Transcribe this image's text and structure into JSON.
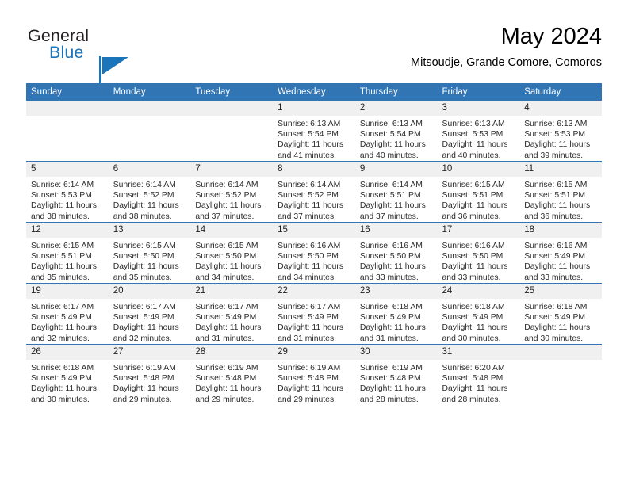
{
  "brand": {
    "name_part1": "General",
    "name_part2": "Blue",
    "accent_color": "#1b75bb"
  },
  "header": {
    "title": "May 2024",
    "subtitle": "Mitsoudje, Grande Comore, Comoros"
  },
  "theme": {
    "header_blue": "#3175b4",
    "daynum_bg": "#f0f0f0"
  },
  "calendar": {
    "weekday_headers": [
      "Sunday",
      "Monday",
      "Tuesday",
      "Wednesday",
      "Thursday",
      "Friday",
      "Saturday"
    ],
    "weeks": [
      [
        {
          "day": "",
          "lines": []
        },
        {
          "day": "",
          "lines": []
        },
        {
          "day": "",
          "lines": []
        },
        {
          "day": "1",
          "lines": [
            "Sunrise: 6:13 AM",
            "Sunset: 5:54 PM",
            "Daylight: 11 hours",
            "and 41 minutes."
          ]
        },
        {
          "day": "2",
          "lines": [
            "Sunrise: 6:13 AM",
            "Sunset: 5:54 PM",
            "Daylight: 11 hours",
            "and 40 minutes."
          ]
        },
        {
          "day": "3",
          "lines": [
            "Sunrise: 6:13 AM",
            "Sunset: 5:53 PM",
            "Daylight: 11 hours",
            "and 40 minutes."
          ]
        },
        {
          "day": "4",
          "lines": [
            "Sunrise: 6:13 AM",
            "Sunset: 5:53 PM",
            "Daylight: 11 hours",
            "and 39 minutes."
          ]
        }
      ],
      [
        {
          "day": "5",
          "lines": [
            "Sunrise: 6:14 AM",
            "Sunset: 5:53 PM",
            "Daylight: 11 hours",
            "and 38 minutes."
          ]
        },
        {
          "day": "6",
          "lines": [
            "Sunrise: 6:14 AM",
            "Sunset: 5:52 PM",
            "Daylight: 11 hours",
            "and 38 minutes."
          ]
        },
        {
          "day": "7",
          "lines": [
            "Sunrise: 6:14 AM",
            "Sunset: 5:52 PM",
            "Daylight: 11 hours",
            "and 37 minutes."
          ]
        },
        {
          "day": "8",
          "lines": [
            "Sunrise: 6:14 AM",
            "Sunset: 5:52 PM",
            "Daylight: 11 hours",
            "and 37 minutes."
          ]
        },
        {
          "day": "9",
          "lines": [
            "Sunrise: 6:14 AM",
            "Sunset: 5:51 PM",
            "Daylight: 11 hours",
            "and 37 minutes."
          ]
        },
        {
          "day": "10",
          "lines": [
            "Sunrise: 6:15 AM",
            "Sunset: 5:51 PM",
            "Daylight: 11 hours",
            "and 36 minutes."
          ]
        },
        {
          "day": "11",
          "lines": [
            "Sunrise: 6:15 AM",
            "Sunset: 5:51 PM",
            "Daylight: 11 hours",
            "and 36 minutes."
          ]
        }
      ],
      [
        {
          "day": "12",
          "lines": [
            "Sunrise: 6:15 AM",
            "Sunset: 5:51 PM",
            "Daylight: 11 hours",
            "and 35 minutes."
          ]
        },
        {
          "day": "13",
          "lines": [
            "Sunrise: 6:15 AM",
            "Sunset: 5:50 PM",
            "Daylight: 11 hours",
            "and 35 minutes."
          ]
        },
        {
          "day": "14",
          "lines": [
            "Sunrise: 6:15 AM",
            "Sunset: 5:50 PM",
            "Daylight: 11 hours",
            "and 34 minutes."
          ]
        },
        {
          "day": "15",
          "lines": [
            "Sunrise: 6:16 AM",
            "Sunset: 5:50 PM",
            "Daylight: 11 hours",
            "and 34 minutes."
          ]
        },
        {
          "day": "16",
          "lines": [
            "Sunrise: 6:16 AM",
            "Sunset: 5:50 PM",
            "Daylight: 11 hours",
            "and 33 minutes."
          ]
        },
        {
          "day": "17",
          "lines": [
            "Sunrise: 6:16 AM",
            "Sunset: 5:50 PM",
            "Daylight: 11 hours",
            "and 33 minutes."
          ]
        },
        {
          "day": "18",
          "lines": [
            "Sunrise: 6:16 AM",
            "Sunset: 5:49 PM",
            "Daylight: 11 hours",
            "and 33 minutes."
          ]
        }
      ],
      [
        {
          "day": "19",
          "lines": [
            "Sunrise: 6:17 AM",
            "Sunset: 5:49 PM",
            "Daylight: 11 hours",
            "and 32 minutes."
          ]
        },
        {
          "day": "20",
          "lines": [
            "Sunrise: 6:17 AM",
            "Sunset: 5:49 PM",
            "Daylight: 11 hours",
            "and 32 minutes."
          ]
        },
        {
          "day": "21",
          "lines": [
            "Sunrise: 6:17 AM",
            "Sunset: 5:49 PM",
            "Daylight: 11 hours",
            "and 31 minutes."
          ]
        },
        {
          "day": "22",
          "lines": [
            "Sunrise: 6:17 AM",
            "Sunset: 5:49 PM",
            "Daylight: 11 hours",
            "and 31 minutes."
          ]
        },
        {
          "day": "23",
          "lines": [
            "Sunrise: 6:18 AM",
            "Sunset: 5:49 PM",
            "Daylight: 11 hours",
            "and 31 minutes."
          ]
        },
        {
          "day": "24",
          "lines": [
            "Sunrise: 6:18 AM",
            "Sunset: 5:49 PM",
            "Daylight: 11 hours",
            "and 30 minutes."
          ]
        },
        {
          "day": "25",
          "lines": [
            "Sunrise: 6:18 AM",
            "Sunset: 5:49 PM",
            "Daylight: 11 hours",
            "and 30 minutes."
          ]
        }
      ],
      [
        {
          "day": "26",
          "lines": [
            "Sunrise: 6:18 AM",
            "Sunset: 5:49 PM",
            "Daylight: 11 hours",
            "and 30 minutes."
          ]
        },
        {
          "day": "27",
          "lines": [
            "Sunrise: 6:19 AM",
            "Sunset: 5:48 PM",
            "Daylight: 11 hours",
            "and 29 minutes."
          ]
        },
        {
          "day": "28",
          "lines": [
            "Sunrise: 6:19 AM",
            "Sunset: 5:48 PM",
            "Daylight: 11 hours",
            "and 29 minutes."
          ]
        },
        {
          "day": "29",
          "lines": [
            "Sunrise: 6:19 AM",
            "Sunset: 5:48 PM",
            "Daylight: 11 hours",
            "and 29 minutes."
          ]
        },
        {
          "day": "30",
          "lines": [
            "Sunrise: 6:19 AM",
            "Sunset: 5:48 PM",
            "Daylight: 11 hours",
            "and 28 minutes."
          ]
        },
        {
          "day": "31",
          "lines": [
            "Sunrise: 6:20 AM",
            "Sunset: 5:48 PM",
            "Daylight: 11 hours",
            "and 28 minutes."
          ]
        },
        {
          "day": "",
          "lines": []
        }
      ]
    ]
  }
}
